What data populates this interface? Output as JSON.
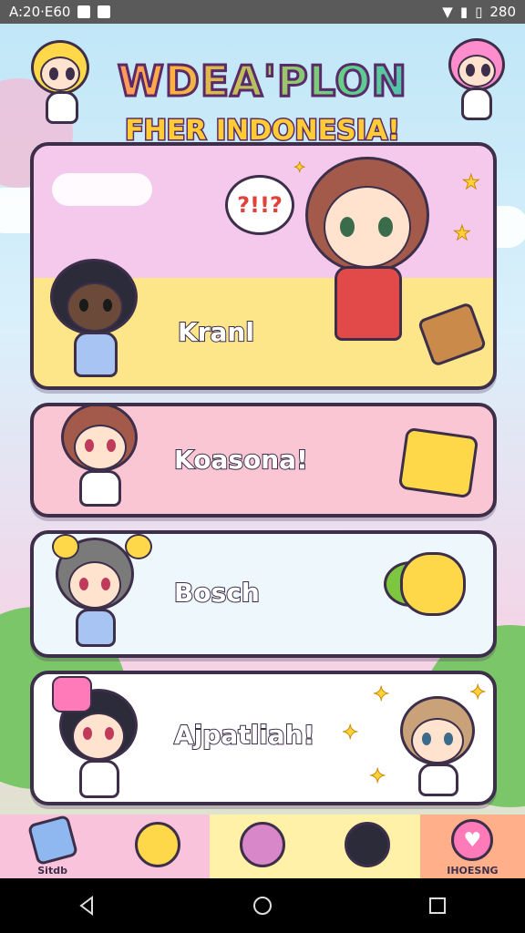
{
  "status_bar": {
    "left_text": "A:20·E60",
    "right_text": "280"
  },
  "header": {
    "title_line1": "WDEA'PLON",
    "title_line2": "FHER INDONESIA!"
  },
  "cards": [
    {
      "label": "Kranl",
      "bubble_text": "?!!?",
      "background": "#fde68a"
    },
    {
      "label": "Koasona!",
      "background": "#fbc6d4"
    },
    {
      "label": "Bosch",
      "background": "#eef7fb"
    },
    {
      "label": "Ajpatliah!",
      "background": "#ffffff"
    }
  ],
  "bottom_nav": {
    "items": [
      {
        "label": "Sitdb",
        "icon": "backpack-icon"
      },
      {
        "label": "",
        "icon": "chibi-blonde-avatar-icon"
      },
      {
        "label": "",
        "icon": "chibi-pink-avatar-icon"
      },
      {
        "label": "",
        "icon": "chibi-dark-avatar-icon"
      },
      {
        "label": "IHOESNG",
        "icon": "heart-icon"
      }
    ]
  },
  "colors": {
    "outline": "#3d2f4a",
    "accent_pink": "#ff5fa2",
    "accent_yellow": "#ffcc33"
  }
}
